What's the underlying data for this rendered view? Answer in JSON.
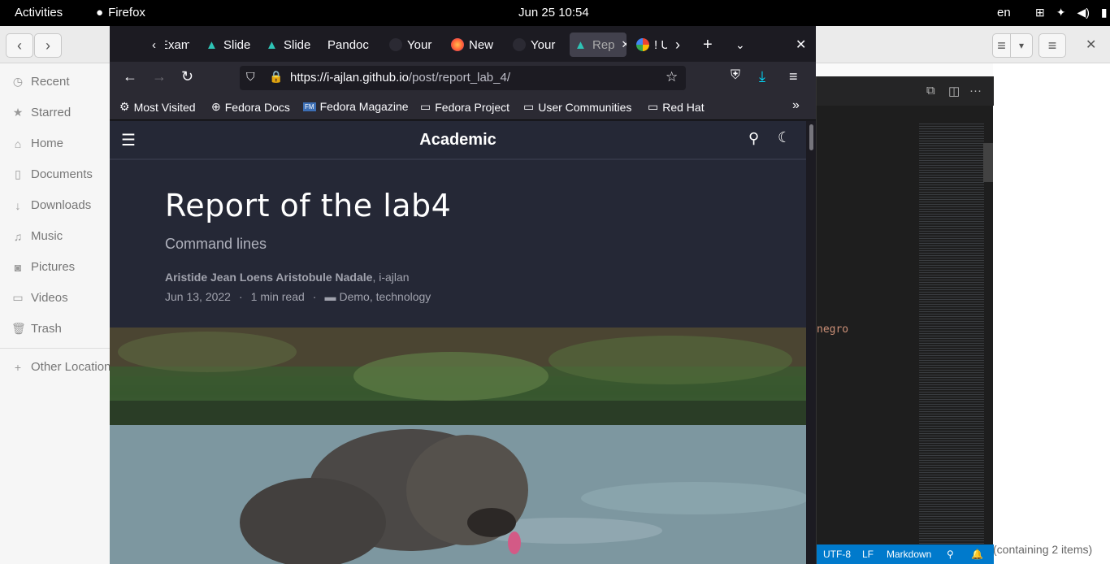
{
  "topbar": {
    "activities": "Activities",
    "app": "Firefox",
    "clock": "Jun 25  10:54",
    "lang": "en"
  },
  "files": {
    "sidebar": [
      {
        "label": "Recent",
        "icon": "clock-icon"
      },
      {
        "label": "Starred",
        "icon": "star-icon"
      },
      {
        "label": "Home",
        "icon": "home-icon"
      },
      {
        "label": "Documents",
        "icon": "document-icon"
      },
      {
        "label": "Downloads",
        "icon": "download-icon"
      },
      {
        "label": "Music",
        "icon": "music-icon"
      },
      {
        "label": "Pictures",
        "icon": "camera-icon"
      },
      {
        "label": "Videos",
        "icon": "video-icon"
      },
      {
        "label": "Trash",
        "icon": "trash-icon"
      },
      {
        "label": "Other Locations",
        "icon": "plus-icon"
      }
    ],
    "status": "(containing 2 items)"
  },
  "vscode": {
    "code_text": "negro",
    "status": {
      "encoding": "UTF-8",
      "eol": "LF",
      "language": "Markdown"
    }
  },
  "firefox": {
    "tabs": [
      {
        "label": "Exam",
        "icon": "",
        "color": "#1c1b22"
      },
      {
        "label": "Slide",
        "icon": "academic-icon",
        "color": "#1c1b22"
      },
      {
        "label": "Slide",
        "icon": "academic-icon",
        "color": "#1c1b22"
      },
      {
        "label": "Pandoc",
        "icon": "",
        "color": "#1c1b22"
      },
      {
        "label": "Your",
        "icon": "github-icon",
        "color": "#1c1b22"
      },
      {
        "label": "New",
        "icon": "firefox-icon",
        "color": "#1c1b22"
      },
      {
        "label": "Your",
        "icon": "github-icon",
        "color": "#1c1b22"
      },
      {
        "label": "Rep",
        "icon": "academic-icon",
        "color": "#42414d"
      },
      {
        "label": "! U",
        "icon": "google-icon",
        "color": "#1c1b22"
      }
    ],
    "url": {
      "domain": "https://i-ajlan.github.io",
      "path": "/post/report_lab_4/"
    },
    "bookmarks": [
      "Most Visited",
      "Fedora Docs",
      "Fedora Magazine",
      "Fedora Project",
      "User Communities",
      "Red Hat"
    ]
  },
  "page": {
    "brand": "Academic",
    "title": "Report of the lab4",
    "subtitle": "Command lines",
    "authors_bold": "Aristide Jean Loens Aristobule Nadale",
    "authors_rest": ", i-ajlan",
    "date": "Jun 13, 2022",
    "read": "1 min read",
    "categories": "Demo, technology"
  }
}
